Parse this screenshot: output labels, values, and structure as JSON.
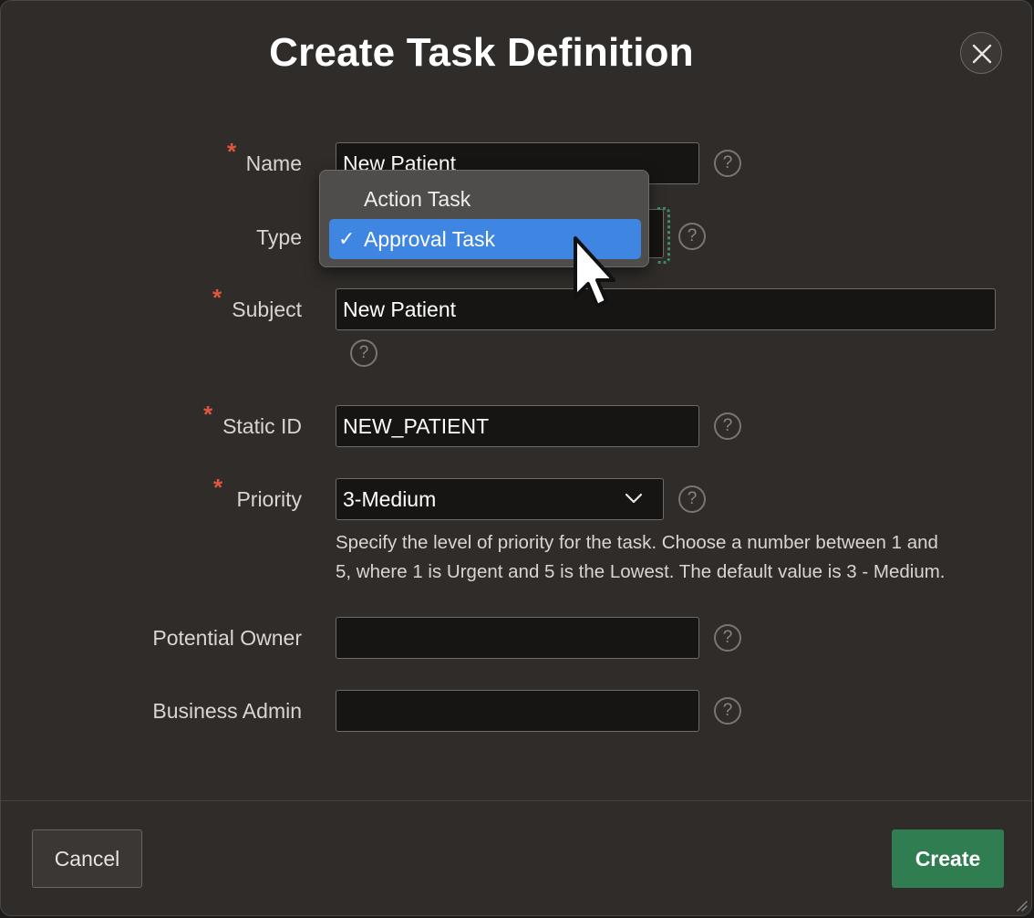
{
  "dialog": {
    "title": "Create Task Definition"
  },
  "form": {
    "name": {
      "label": "Name",
      "value": "New Patient",
      "required": true
    },
    "type": {
      "label": "Type",
      "options": [
        "Action Task",
        "Approval Task"
      ],
      "selected": "Approval Task",
      "check_mark": "✓"
    },
    "subject": {
      "label": "Subject",
      "value": "New Patient",
      "required": true
    },
    "static_id": {
      "label": "Static ID",
      "value": "NEW_PATIENT",
      "required": true
    },
    "priority": {
      "label": "Priority",
      "value": "3-Medium",
      "required": true,
      "hint_line1": "Specify the level of priority for the task. Choose a number between 1 and",
      "hint_line2": "5, where 1 is Urgent and 5 is the Lowest. The default value is 3 - Medium."
    },
    "potential_owner": {
      "label": "Potential Owner",
      "value": ""
    },
    "business_admin": {
      "label": "Business Admin",
      "value": ""
    },
    "required_mark": "*",
    "help_mark": "?"
  },
  "footer": {
    "cancel_label": "Cancel",
    "create_label": "Create"
  },
  "colors": {
    "dialog_bg": "#2f2c29",
    "accent_selected": "#3f86e3",
    "create_button": "#2f7d51",
    "required": "#e0573f"
  }
}
